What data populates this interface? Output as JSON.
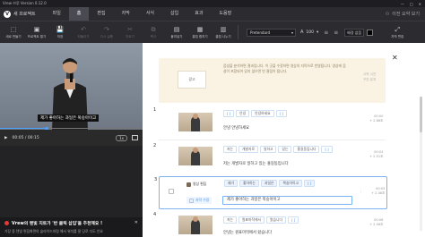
{
  "window": {
    "title": "Vrew 브루 Version 0.12.0",
    "min": "—",
    "max": "□",
    "close": "✕"
  },
  "menubar": {
    "logo": "V",
    "logo_label": "새 프로젝트",
    "items": [
      "파일",
      "홈",
      "편집",
      "자막",
      "서식",
      "삽입",
      "효과",
      "도움말"
    ],
    "active": "홈",
    "right": "이전 요약 보기"
  },
  "toolbar": {
    "tools": [
      {
        "icon": "⬚",
        "label": "새로 만들기",
        "dim": false
      },
      {
        "icon": "▣",
        "label": "프로젝트 열기",
        "dim": false
      },
      {
        "icon": "💾",
        "label": "저장",
        "dim": false
      },
      {
        "icon": "↶",
        "label": "되돌리기",
        "dim": true
      },
      {
        "icon": "↷",
        "label": "다시 실행",
        "dim": true
      },
      {
        "icon": "✂",
        "label": "자르기",
        "dim": true
      },
      {
        "icon": "⧉",
        "label": "복사",
        "dim": true
      },
      {
        "icon": "▤",
        "label": "붙여넣기",
        "dim": false
      },
      {
        "icon": "▦",
        "label": "클립 합치기",
        "dim": false
      },
      {
        "icon": "▥",
        "label": "클립 나누기",
        "dim": false
      }
    ],
    "font": "Pretendard",
    "font_caret": "▾",
    "text_color_icon": "A",
    "size": "100",
    "size_caret": "▾",
    "line_icons": "≡ ≡",
    "background_select": "배경 없음",
    "swatch_color": "#000000",
    "edit_icon": "⤢",
    "edit_label": "자막 편집"
  },
  "video": {
    "subtitle_overlay": "제가 좋아하는 과일은 복숭아이고",
    "time": "00:05 / 00:15",
    "progress_fraction": 0.33,
    "speed": "1x",
    "play_icon": "▶"
  },
  "notice": {
    "title": "Vrew의 텐빛 지토가 '반 클릭 삽입'을 추천해요 !",
    "body": "가장 중 텐빛 편집화면의 슬라이드처럼 해서 워치를 잘 당로 다도 안요",
    "close": "✕"
  },
  "promo": {
    "box_label": "광고",
    "text": "음성을 분석하면 결과입니다. 이 곳을 수정하면 영상의 자막으로 반영됩니다. 영상에 음성이 포함되어 있지 않으면 빈 클립이 됩니다.",
    "side": "시작 시간\n구간 유지"
  },
  "rows": [
    {
      "num": "1",
      "chips": [
        "[ ]",
        "안녕",
        "안녕하세요",
        "[ ]"
      ],
      "text": "안녕 안녕하세요",
      "time": "00:00",
      "dur": "+ 2.66초"
    },
    {
      "num": "2",
      "chips": [
        "저는",
        "개발자로",
        "일하고",
        "있는",
        "홍길동입니다",
        "[ ]"
      ],
      "text": "저는 개발자로 일하고 있는 홍길동입니다",
      "time": "00:03",
      "dur": "+ 2.51초"
    },
    {
      "num": "3",
      "badge_video": "영상 편집",
      "chips": [
        "제가",
        "좋아하는",
        "과일은",
        "복숭아이고",
        "[ ]"
      ],
      "badge_sub": "자막 수정",
      "input": "제가 좋아하는 과일은 복숭아이고",
      "time": "00:05",
      "dur": "+ 2.48초"
    },
    {
      "num": "4",
      "chips": [
        "저는",
        "원표마작에서",
        "왔습니다",
        "[ ]"
      ],
      "text": "안녕는 원표마작에서 왔습니다",
      "time": "00:08",
      "dur": "+ 2.56초"
    }
  ],
  "close_panel": "✕"
}
